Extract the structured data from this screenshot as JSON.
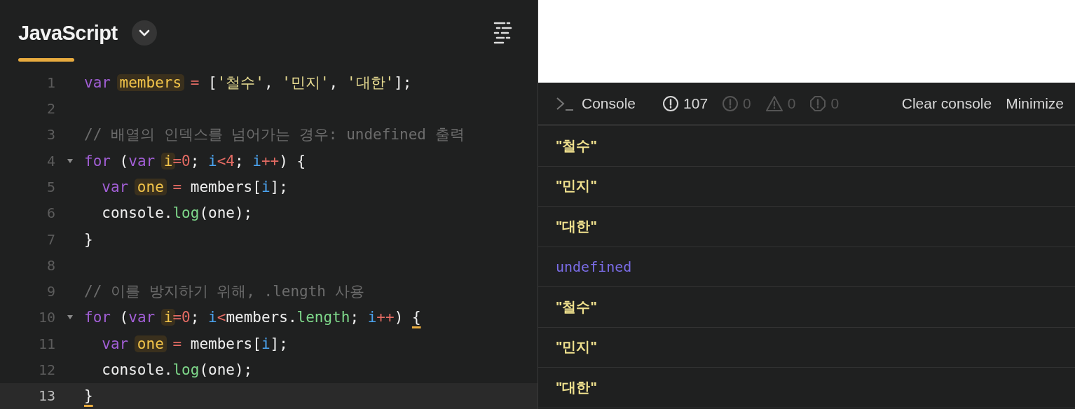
{
  "editor": {
    "language": "JavaScript",
    "tab_selected": true,
    "lines": [
      {
        "number": "1",
        "fold": false,
        "current": false,
        "tokens": [
          {
            "kind": "keyword",
            "text": "var "
          },
          {
            "kind": "highlight",
            "text": "members"
          },
          {
            "kind": "operator",
            "text": " ="
          },
          {
            "kind": "plain",
            "text": " ["
          },
          {
            "kind": "string",
            "text": "'철수'"
          },
          {
            "kind": "plain",
            "text": ", "
          },
          {
            "kind": "string",
            "text": "'민지'"
          },
          {
            "kind": "plain",
            "text": ", "
          },
          {
            "kind": "string",
            "text": "'대한'"
          },
          {
            "kind": "plain",
            "text": "];"
          }
        ]
      },
      {
        "number": "2",
        "fold": false,
        "current": false
      },
      {
        "number": "3",
        "fold": false,
        "current": false,
        "tokens": [
          {
            "kind": "comment",
            "text": "// 배열의 인덱스를 넘어가는 경우: undefined 출력"
          }
        ]
      },
      {
        "number": "4",
        "fold": true,
        "current": false,
        "tokens": [
          {
            "kind": "keyword",
            "text": "for"
          },
          {
            "kind": "plain",
            "text": " ("
          },
          {
            "kind": "keyword",
            "text": "var "
          },
          {
            "kind": "highlight",
            "text": "i"
          },
          {
            "kind": "operator",
            "text": "=0"
          },
          {
            "kind": "plain",
            "text": "; "
          },
          {
            "kind": "index",
            "text": "i"
          },
          {
            "kind": "operator",
            "text": "<4"
          },
          {
            "kind": "plain",
            "text": "; "
          },
          {
            "kind": "index",
            "text": "i"
          },
          {
            "kind": "operator",
            "text": "++"
          },
          {
            "kind": "plain",
            "text": ") {"
          }
        ]
      },
      {
        "number": "5",
        "fold": false,
        "current": false,
        "tokens": [
          {
            "kind": "keyword",
            "text": "  var "
          },
          {
            "kind": "highlight",
            "text": "one"
          },
          {
            "kind": "operator",
            "text": " ="
          },
          {
            "kind": "plain",
            "text": " members["
          },
          {
            "kind": "index",
            "text": "i"
          },
          {
            "kind": "plain",
            "text": "];"
          }
        ]
      },
      {
        "number": "6",
        "fold": false,
        "current": false,
        "tokens": [
          {
            "kind": "plain",
            "text": "  console."
          },
          {
            "kind": "method",
            "text": "log"
          },
          {
            "kind": "plain",
            "text": "(one);"
          }
        ]
      },
      {
        "number": "7",
        "fold": false,
        "current": false,
        "tokens": [
          {
            "kind": "plain",
            "text": "}"
          }
        ]
      },
      {
        "number": "8",
        "fold": false,
        "current": false
      },
      {
        "number": "9",
        "fold": false,
        "current": false,
        "tokens": [
          {
            "kind": "comment",
            "text": "// 이를 방지하기 위해, .length 사용"
          }
        ]
      },
      {
        "number": "10",
        "fold": true,
        "current": false,
        "tokens": [
          {
            "kind": "keyword",
            "text": "for"
          },
          {
            "kind": "plain",
            "text": " ("
          },
          {
            "kind": "keyword",
            "text": "var "
          },
          {
            "kind": "highlight",
            "text": "i"
          },
          {
            "kind": "operator",
            "text": "=0"
          },
          {
            "kind": "plain",
            "text": "; "
          },
          {
            "kind": "index",
            "text": "i"
          },
          {
            "kind": "operator",
            "text": "<"
          },
          {
            "kind": "plain",
            "text": "members."
          },
          {
            "kind": "method",
            "text": "length"
          },
          {
            "kind": "plain",
            "text": "; "
          },
          {
            "kind": "index",
            "text": "i"
          },
          {
            "kind": "operator",
            "text": "++"
          },
          {
            "kind": "plain",
            "text": ") "
          },
          {
            "kind": "bracket",
            "text": "{"
          }
        ]
      },
      {
        "number": "11",
        "fold": false,
        "current": false,
        "tokens": [
          {
            "kind": "keyword",
            "text": "  var "
          },
          {
            "kind": "highlight",
            "text": "one"
          },
          {
            "kind": "operator",
            "text": " ="
          },
          {
            "kind": "plain",
            "text": " members["
          },
          {
            "kind": "index",
            "text": "i"
          },
          {
            "kind": "plain",
            "text": "];"
          }
        ]
      },
      {
        "number": "12",
        "fold": false,
        "current": false,
        "tokens": [
          {
            "kind": "plain",
            "text": "  console."
          },
          {
            "kind": "method",
            "text": "log"
          },
          {
            "kind": "plain",
            "text": "(one);"
          }
        ]
      },
      {
        "number": "13",
        "fold": false,
        "current": true,
        "tokens": [
          {
            "kind": "bracket",
            "text": "}"
          }
        ]
      }
    ]
  },
  "console": {
    "title": "Console",
    "counters": [
      {
        "kind": "info",
        "count": "107",
        "active": true
      },
      {
        "kind": "error",
        "count": "0",
        "active": false
      },
      {
        "kind": "warning",
        "count": "0",
        "active": false
      },
      {
        "kind": "blocked",
        "count": "0",
        "active": false
      }
    ],
    "buttons": [
      "Clear console",
      "Minimize"
    ],
    "entries": [
      {
        "kind": "string",
        "text": "\"철수\""
      },
      {
        "kind": "string",
        "text": "\"민지\""
      },
      {
        "kind": "string",
        "text": "\"대한\""
      },
      {
        "kind": "undefined",
        "text": "undefined"
      },
      {
        "kind": "string",
        "text": "\"철수\""
      },
      {
        "kind": "string",
        "text": "\"민지\""
      },
      {
        "kind": "string",
        "text": "\"대한\""
      }
    ]
  }
}
